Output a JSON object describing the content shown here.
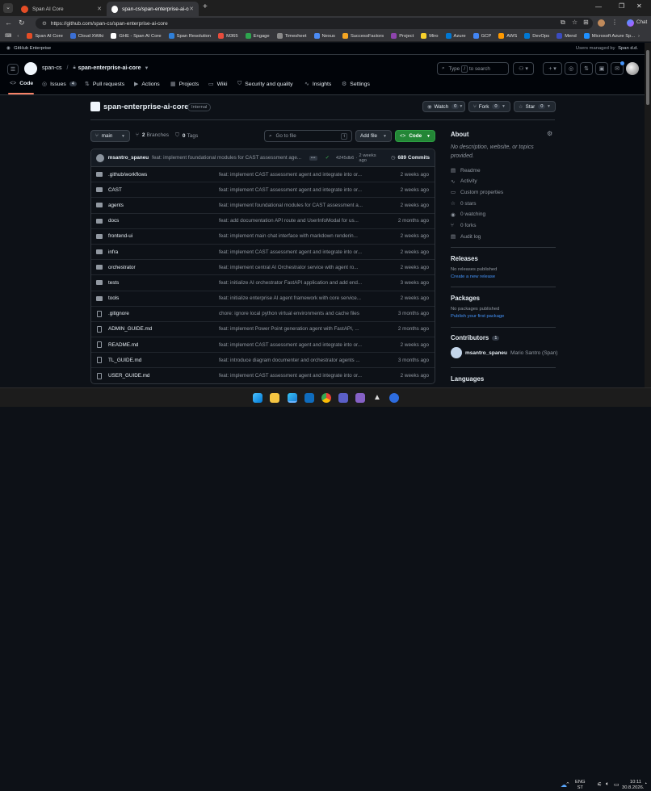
{
  "browser": {
    "tabs": [
      {
        "title": "Span AI Core",
        "active": false
      },
      {
        "title": "span-cs/span-enterprise-ai-core",
        "active": true
      }
    ],
    "url": "https://github.com/span-cs/span-enterprise-ai-core",
    "chat_label": "Chat",
    "bookmarks": [
      "Span AI Core",
      "Cloud XWiki",
      "GHE - Span AI Core",
      "Span Resolution",
      "M365",
      "Engage",
      "Timesheet",
      "Nexus",
      "SuccessFactors",
      "Project",
      "Miro",
      "Azure",
      "GCP",
      "AWS",
      "DevOps",
      "Mend",
      "Microsoft Azure Sp..."
    ],
    "bookmark_colors": [
      "#e44d26",
      "#3b6fd4",
      "#ffffff",
      "#2f7fd8",
      "#e74c3c",
      "#2da44e",
      "#8a8a8a",
      "#4b8bf4",
      "#f5a623",
      "#8e44ad",
      "#f7d02c",
      "#0078d4",
      "#4285f4",
      "#ff9900",
      "#0078d4",
      "#3b4cc0",
      "#1e90ff"
    ]
  },
  "enterprise": {
    "label": "GitHub Enterprise",
    "managed_by": "Users managed by",
    "managed_org": "Span d.d."
  },
  "header": {
    "owner": "span-cs",
    "repo": "span-enterprise-ai-core",
    "search_prefix": "Type",
    "search_key": "/",
    "search_suffix": "to search"
  },
  "nav": [
    {
      "label": "Code",
      "icon": "<>",
      "count": ""
    },
    {
      "label": "Issues",
      "icon": "◎",
      "count": "4"
    },
    {
      "label": "Pull requests",
      "icon": "⇅",
      "count": ""
    },
    {
      "label": "Actions",
      "icon": "▶",
      "count": ""
    },
    {
      "label": "Projects",
      "icon": "▦",
      "count": ""
    },
    {
      "label": "Wiki",
      "icon": "▭",
      "count": ""
    },
    {
      "label": "Security and quality",
      "icon": "⛉",
      "count": ""
    },
    {
      "label": "Insights",
      "icon": "∿",
      "count": ""
    },
    {
      "label": "Settings",
      "icon": "⚙",
      "count": ""
    }
  ],
  "repo": {
    "name": "span-enterprise-ai-core",
    "visibility": "Internal",
    "watch_label": "Watch",
    "watch_count": "0",
    "fork_label": "Fork",
    "fork_count": "0",
    "star_label": "Star",
    "star_count": "0"
  },
  "toolbar": {
    "branch": "main",
    "branches_count": "2",
    "branches_label": "Branches",
    "tags_count": "0",
    "tags_label": "Tags",
    "goto_placeholder": "Go to file",
    "goto_key": "t",
    "add_file_label": "Add file",
    "code_label": "Code"
  },
  "commit": {
    "author": "msantro_spaneu",
    "message": "feat: implement foundational modules for CAST assessment age...",
    "sha": "4245db6",
    "age": "2 weeks ago",
    "count": "689",
    "count_label": "Commits"
  },
  "files": [
    {
      "name": ".github/workflows",
      "type": "dir",
      "message": "feat: implement CAST assessment agent and integrate into or...",
      "age": "2 weeks ago"
    },
    {
      "name": "CAST",
      "type": "dir",
      "message": "feat: implement CAST assessment agent and integrate into or...",
      "age": "2 weeks ago"
    },
    {
      "name": "agents",
      "type": "dir",
      "message": "feat: implement foundational modules for CAST assessment a...",
      "age": "2 weeks ago"
    },
    {
      "name": "docs",
      "type": "dir",
      "message": "feat: add documentation API route and UserInfoModal for us...",
      "age": "2 months ago"
    },
    {
      "name": "frontend-ui",
      "type": "dir",
      "message": "feat: implement main chat interface with markdown renderin...",
      "age": "2 weeks ago"
    },
    {
      "name": "infra",
      "type": "dir",
      "message": "feat: implement CAST assessment agent and integrate into or...",
      "age": "2 weeks ago"
    },
    {
      "name": "orchestrator",
      "type": "dir",
      "message": "feat: implement central AI Orchestrator service with agent ro...",
      "age": "2 weeks ago"
    },
    {
      "name": "tests",
      "type": "dir",
      "message": "feat: initialize AI orchestrator FastAPI application and add end...",
      "age": "3 weeks ago"
    },
    {
      "name": "tools",
      "type": "dir",
      "message": "feat: initialize enterprise AI agent framework with core service...",
      "age": "2 weeks ago"
    },
    {
      "name": ".gitignore",
      "type": "file",
      "message": "chore: ignore local python virtual environments and cache files",
      "age": "3 months ago"
    },
    {
      "name": "ADMIN_GUIDE.md",
      "type": "file",
      "message": "feat: implement Power Point generation agent with FastAPI, ...",
      "age": "2 months ago"
    },
    {
      "name": "README.md",
      "type": "file",
      "message": "feat: implement CAST assessment agent and integrate into or...",
      "age": "2 weeks ago"
    },
    {
      "name": "TL_GUIDE.md",
      "type": "file",
      "message": "feat: introduce diagram documenter and orchestrator agents ...",
      "age": "3 months ago"
    },
    {
      "name": "USER_GUIDE.md",
      "type": "file",
      "message": "feat: implement CAST assessment agent and integrate into or...",
      "age": "2 weeks ago"
    }
  ],
  "about": {
    "title": "About",
    "description_1": "No description, website, or topics",
    "description_2": "provided.",
    "items": [
      {
        "label": "Readme",
        "icon": "▤"
      },
      {
        "label": "Activity",
        "icon": "∿"
      },
      {
        "label": "Custom properties",
        "icon": "▭"
      },
      {
        "label": "0 stars",
        "icon": "☆"
      },
      {
        "label": "0 watching",
        "icon": "◉"
      },
      {
        "label": "0 forks",
        "icon": "⑂"
      },
      {
        "label": "Audit log",
        "icon": "▤"
      }
    ]
  },
  "releases": {
    "title": "Releases",
    "empty": "No releases published",
    "link": "Create a new release"
  },
  "packages": {
    "title": "Packages",
    "empty": "No packages published",
    "link": "Publish your first package"
  },
  "contributors": {
    "title": "Contributors",
    "count": "1",
    "user": "msantro_spaneu",
    "full_name": "Mario Santro (Span)"
  },
  "languages": {
    "title": "Languages"
  },
  "taskbar": {
    "lang_1": "ENG",
    "lang_2": "ST",
    "time": "10:11",
    "date": "30.8.2026."
  }
}
